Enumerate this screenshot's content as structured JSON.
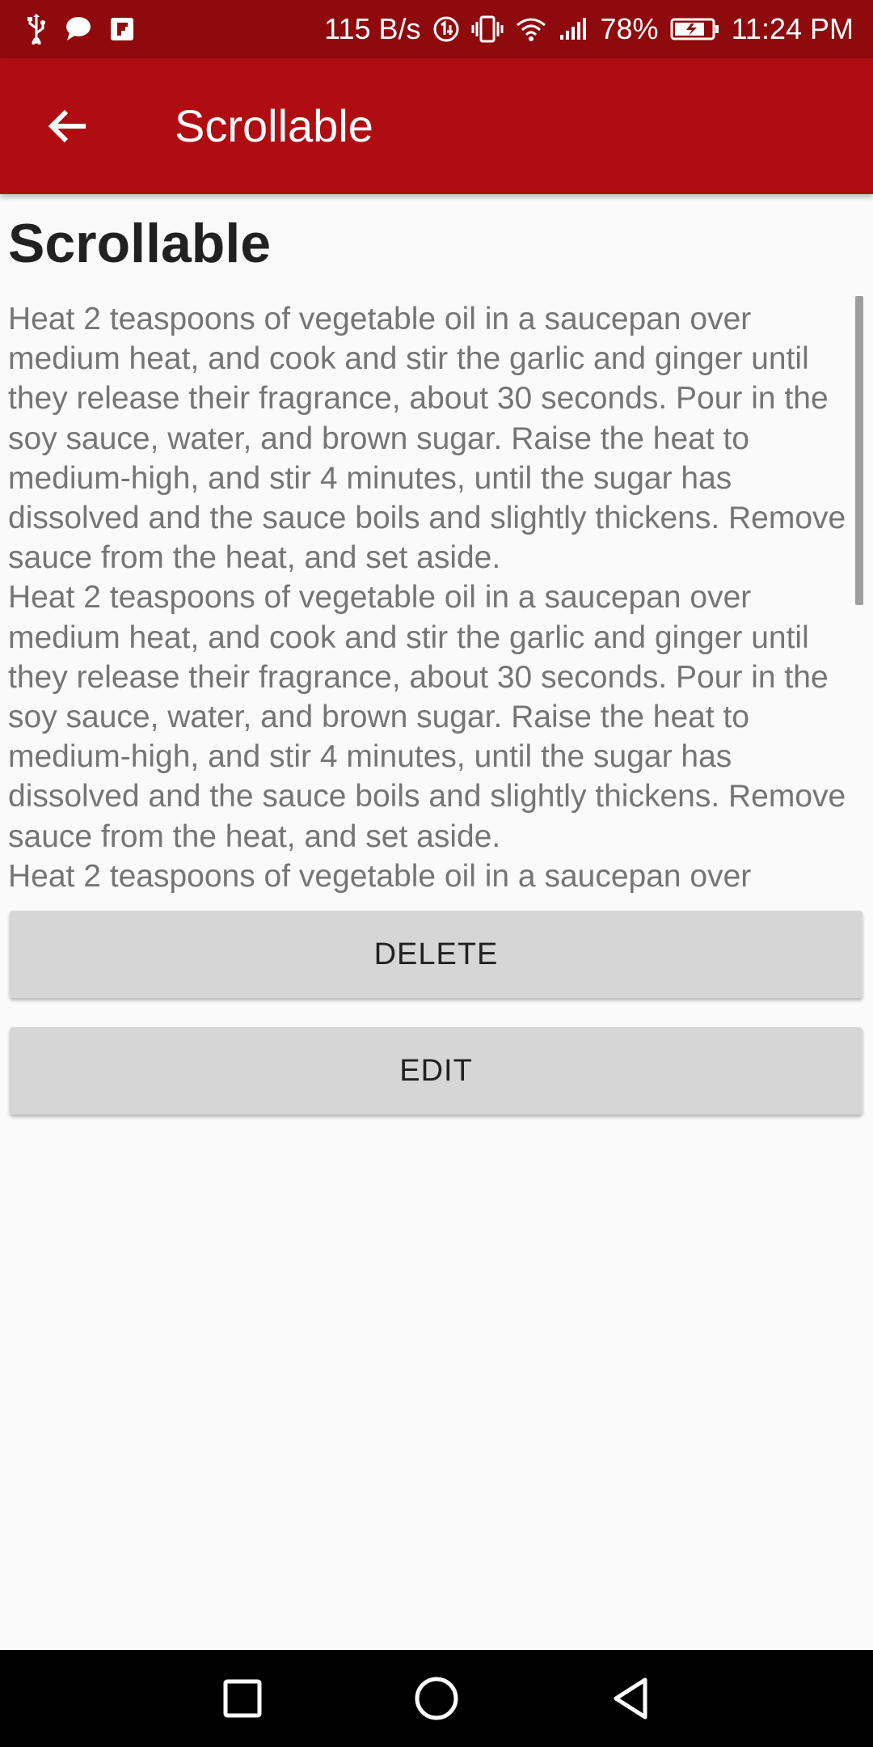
{
  "status_bar": {
    "network_speed": "115 B/s",
    "battery_percent": "78%",
    "time": "11:24 PM",
    "icons": [
      "usb-icon",
      "chat-icon",
      "flipboard-icon",
      "data-saver-icon",
      "vibrate-icon",
      "wifi-icon",
      "signal-icon",
      "battery-icon"
    ]
  },
  "app_bar": {
    "title": "Scrollable",
    "back_icon": "arrow-back-icon"
  },
  "content": {
    "heading": "Scrollable",
    "body": "Heat 2 teaspoons of vegetable oil in a saucepan over medium heat, and cook and stir the garlic and ginger until they release their fragrance, about 30 seconds. Pour in the soy sauce, water, and brown sugar. Raise the heat to medium-high, and stir 4 minutes, until the sugar has dissolved and the sauce boils and slightly thickens. Remove sauce from the heat, and set aside.\nHeat 2 teaspoons of vegetable oil in a saucepan over medium heat, and cook and stir the garlic and ginger until they release their fragrance, about 30 seconds. Pour in the soy sauce, water, and brown sugar. Raise the heat to medium-high, and stir 4 minutes, until the sugar has dissolved and the sauce boils and slightly thickens. Remove sauce from the heat, and set aside.\nHeat 2 teaspoons of vegetable oil in a saucepan over"
  },
  "buttons": {
    "delete_label": "DELETE",
    "edit_label": "EDIT"
  },
  "nav_bar": {
    "items": [
      "recents-icon",
      "home-icon",
      "back-icon"
    ]
  },
  "colors": {
    "status_bar": "#8e0a0d",
    "app_bar": "#b00d12",
    "background": "#fafafa",
    "button": "#d6d6d6",
    "body_text": "#757575",
    "heading_text": "#212121"
  }
}
